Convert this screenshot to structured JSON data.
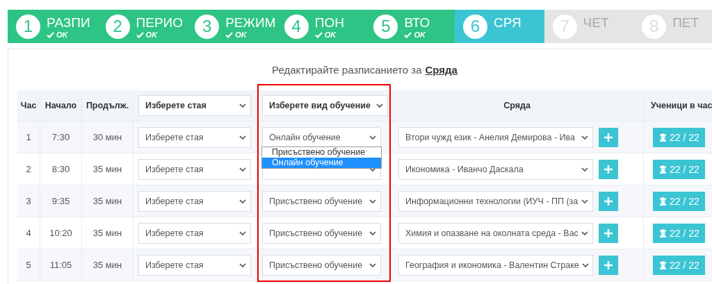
{
  "steps": [
    {
      "number": "1",
      "label": "РАЗПИ",
      "completed": true,
      "selected": false,
      "status": "OK"
    },
    {
      "number": "2",
      "label": "ПЕРИО",
      "completed": true,
      "selected": false,
      "status": "OK"
    },
    {
      "number": "3",
      "label": "РЕЖИМ",
      "completed": true,
      "selected": false,
      "status": "OK"
    },
    {
      "number": "4",
      "label": "ПОН",
      "completed": true,
      "selected": false,
      "status": "OK"
    },
    {
      "number": "5",
      "label": "ВТО",
      "completed": true,
      "selected": false,
      "status": "OK"
    },
    {
      "number": "6",
      "label": "СРЯ",
      "completed": false,
      "selected": true
    },
    {
      "number": "7",
      "label": "ЧЕТ",
      "completed": false,
      "selected": false
    },
    {
      "number": "8",
      "label": "ПЕТ",
      "completed": false,
      "selected": false
    }
  ],
  "heading": {
    "text": "Редактирайте разписанието за",
    "link": "Сряда"
  },
  "table": {
    "columns": [
      "Час",
      "Начало",
      "Продълж.",
      "Изберете стая",
      "Изберете вид обучение",
      "Сряда",
      "Ученици в час"
    ],
    "rows": [
      {
        "hour": "1",
        "start": "7:30",
        "duration": "30 мин",
        "room": "Изберете стая",
        "type": "Онлайн обучение",
        "subject": "Втори чужд език - Анелия Демирова - Ива",
        "students": "22 / 22",
        "dropdown": {
          "options": [
            {
              "label": "Присъствено обучение",
              "selected": false
            },
            {
              "label": "Онлайн обучение",
              "selected": true
            }
          ]
        }
      },
      {
        "hour": "2",
        "start": "8:30",
        "duration": "35 мин",
        "room": "Изберете стая",
        "subject": "Икономика - Иванчо Даскала",
        "students": "22 / 22"
      },
      {
        "hour": "3",
        "start": "9:35",
        "duration": "35 мин",
        "room": "Изберете стая",
        "type": "Присъствено обучение",
        "subject": "Информационни технологии (ИУЧ - ПП (за",
        "students": "22 / 22"
      },
      {
        "hour": "4",
        "start": "10:20",
        "duration": "35 мин",
        "room": "Изберете стая",
        "type": "Присъствено обучение",
        "subject": "Химия и опазване на околната среда - Вас",
        "students": "22 / 22"
      },
      {
        "hour": "5",
        "start": "11:05",
        "duration": "35 мин",
        "room": "Изберете стая",
        "type": "Присъствено обучение",
        "subject": "География и икономика - Валентин Страке",
        "students": "22 / 22"
      }
    ]
  }
}
